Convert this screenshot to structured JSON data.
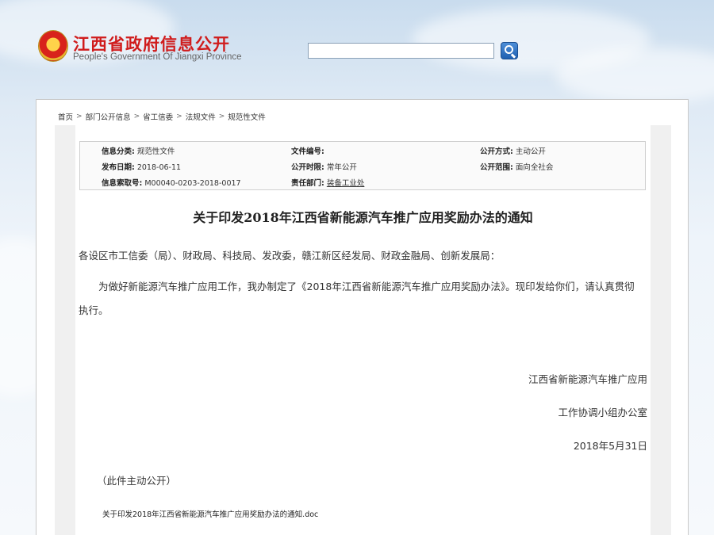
{
  "header": {
    "site_title": "江西省政府信息公开",
    "site_subtitle": "People's Government Of Jiangxi Province",
    "search": {
      "value": "",
      "placeholder": ""
    },
    "search_button_icon": "search-icon",
    "emblem_icon": "national-emblem-icon"
  },
  "breadcrumb": {
    "items": [
      "首页",
      "部门公开信息",
      "省工信委",
      "法规文件",
      "规范性文件"
    ],
    "separator_icon": "chevron-right-icon"
  },
  "meta": {
    "category": {
      "key": "信息分类:",
      "value": "规范性文件"
    },
    "doc_number": {
      "key": "文件编号:",
      "value": ""
    },
    "open_mode": {
      "key": "公开方式:",
      "value": "主动公开"
    },
    "publish_date": {
      "key": "发布日期:",
      "value": "2018-06-11"
    },
    "open_time": {
      "key": "公开时限:",
      "value": "常年公开"
    },
    "open_scope": {
      "key": "公开范围:",
      "value": "面向全社会"
    },
    "index_number": {
      "key": "信息索取号:",
      "value": "M00040-0203-2018-0017"
    },
    "department": {
      "key": "责任部门:",
      "value": "装备工业处"
    }
  },
  "document": {
    "title": "关于印发2018年江西省新能源汽车推广应用奖励办法的通知",
    "addressee": "各设区市工信委（局）、财政局、科技局、发改委，赣江新区经发局、财政金融局、创新发展局：",
    "body": "为做好新能源汽车推广应用工作，我办制定了《2018年江西省新能源汽车推广应用奖励办法》。现印发给你们，请认真贯彻执行。",
    "signature_line1": "江西省新能源汽车推广应用",
    "signature_line2": "工作协调小组办公室",
    "date": "2018年5月31日",
    "note": "（此件主动公开）",
    "attachment": "关于印发2018年江西省新能源汽车推广应用奖励办法的通知.doc"
  },
  "colors": {
    "title_red": "#d01c1c",
    "search_button_blue": "#1f5fb0"
  }
}
